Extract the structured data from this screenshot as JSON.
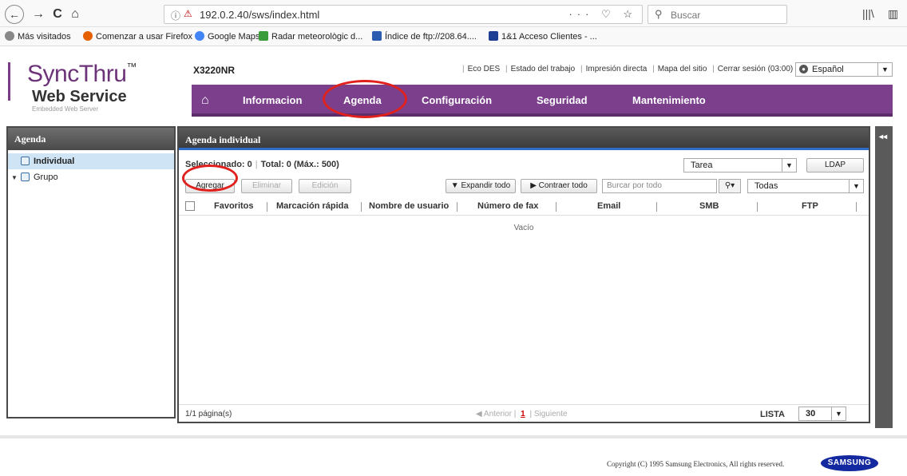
{
  "browser": {
    "back": "←",
    "forward": "→",
    "reload": "C",
    "home": "⌂",
    "url": "192.0.2.40/sws/index.html",
    "url_tools": "··· ♡ ☆",
    "search_placeholder": "Buscar",
    "right_icons": [
      "|||\\",
      "▥"
    ]
  },
  "bookmarks": [
    {
      "label": "Más visitados",
      "color": "#888888"
    },
    {
      "label": "Comenzar a usar Firefox",
      "color": "#e66000"
    },
    {
      "label": "Google Maps",
      "color": "#4285f4"
    },
    {
      "label": "Radar meteorològic d...",
      "color": "#3a9c3a"
    },
    {
      "label": "Índice de ftp://208.64....",
      "color": "#2a5db0"
    },
    {
      "label": "1&1 Acceso Clientes - ...",
      "color": "#1c3f94"
    }
  ],
  "header": {
    "logo_title": "SyncThru",
    "logo_tm": "™",
    "logo_subtitle": "Web Service",
    "logo_embedded": "Embedded Web Server",
    "model": "X3220NR",
    "top_links": [
      "Eco DES",
      "Estado del trabajo",
      "Impresión directa",
      "Mapa del sitio",
      "Cerrar sesión (03:00)"
    ],
    "language": "Español"
  },
  "nav": {
    "items": [
      "Informacion",
      "Agenda",
      "Configuración",
      "Seguridad",
      "Mantenimiento"
    ]
  },
  "sidebar": {
    "title": "Agenda",
    "items": [
      {
        "label": "Individual",
        "selected": true
      },
      {
        "label": "Grupo",
        "selected": false
      }
    ]
  },
  "panel": {
    "title": "Agenda individual",
    "selected_label": "Seleccionado: 0",
    "total_label": "Total: 0 (Máx.: 500)",
    "task_select": "Tarea",
    "ldap_button": "LDAP",
    "add_button": "Agregar",
    "delete_button": "Eliminar",
    "edit_button": "Edición",
    "expand_all": "▼ Expandir todo",
    "collapse_all": "▶ Contraer todo",
    "search_placeholder": "Burcar por todo",
    "filter_select": "Todas",
    "columns": [
      "Favoritos",
      "Marcación rápida",
      "Nombre de usuario",
      "Número de fax",
      "Email",
      "SMB",
      "FTP"
    ],
    "empty": "Vacío",
    "page_count": "1/1 página(s)",
    "prev": "◀ Anterior",
    "current_page": "1",
    "next": "Siguiente",
    "list_label": "LISTA",
    "list_size": "30"
  },
  "footer": {
    "copyright": "Copyright (C) 1995 Samsung Electronics, All rights reserved.",
    "brand": "SAMSUNG"
  }
}
